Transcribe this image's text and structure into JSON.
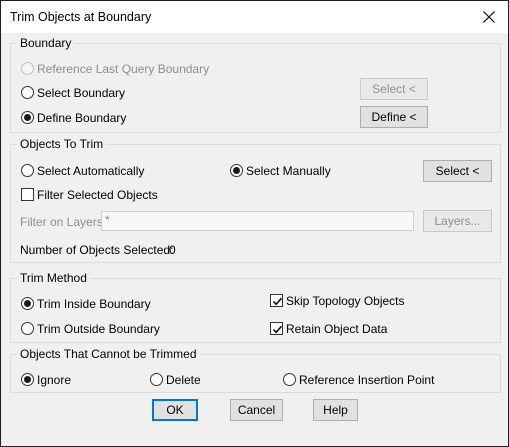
{
  "window": {
    "title": "Trim Objects at Boundary"
  },
  "boundary": {
    "legend": "Boundary",
    "reference_last": "Reference Last Query Boundary",
    "select_boundary": "Select Boundary",
    "define_boundary": "Define Boundary",
    "select_button": "Select <",
    "define_button": "Define <"
  },
  "objects_to_trim": {
    "legend": "Objects To Trim",
    "select_auto": "Select Automatically",
    "select_manual": "Select Manually",
    "select_button": "Select <",
    "filter_selected": "Filter Selected Objects",
    "filter_layers_label": "Filter on Layers:",
    "filter_layers_value": "*",
    "layers_button": "Layers...",
    "count_label": "Number of Objects Selected:",
    "count_value": "0"
  },
  "trim_method": {
    "legend": "Trim Method",
    "inside": "Trim Inside Boundary",
    "outside": "Trim Outside Boundary",
    "skip_topology": "Skip Topology Objects",
    "retain_data": "Retain Object Data"
  },
  "cannot_trim": {
    "legend": "Objects That Cannot be Trimmed",
    "ignore": "Ignore",
    "delete": "Delete",
    "ref_insertion": "Reference Insertion Point"
  },
  "footer": {
    "ok": "OK",
    "cancel": "Cancel",
    "help": "Help"
  },
  "colors": {
    "accent": "#0078d7",
    "dialog_bg": "#f0f0f0"
  }
}
